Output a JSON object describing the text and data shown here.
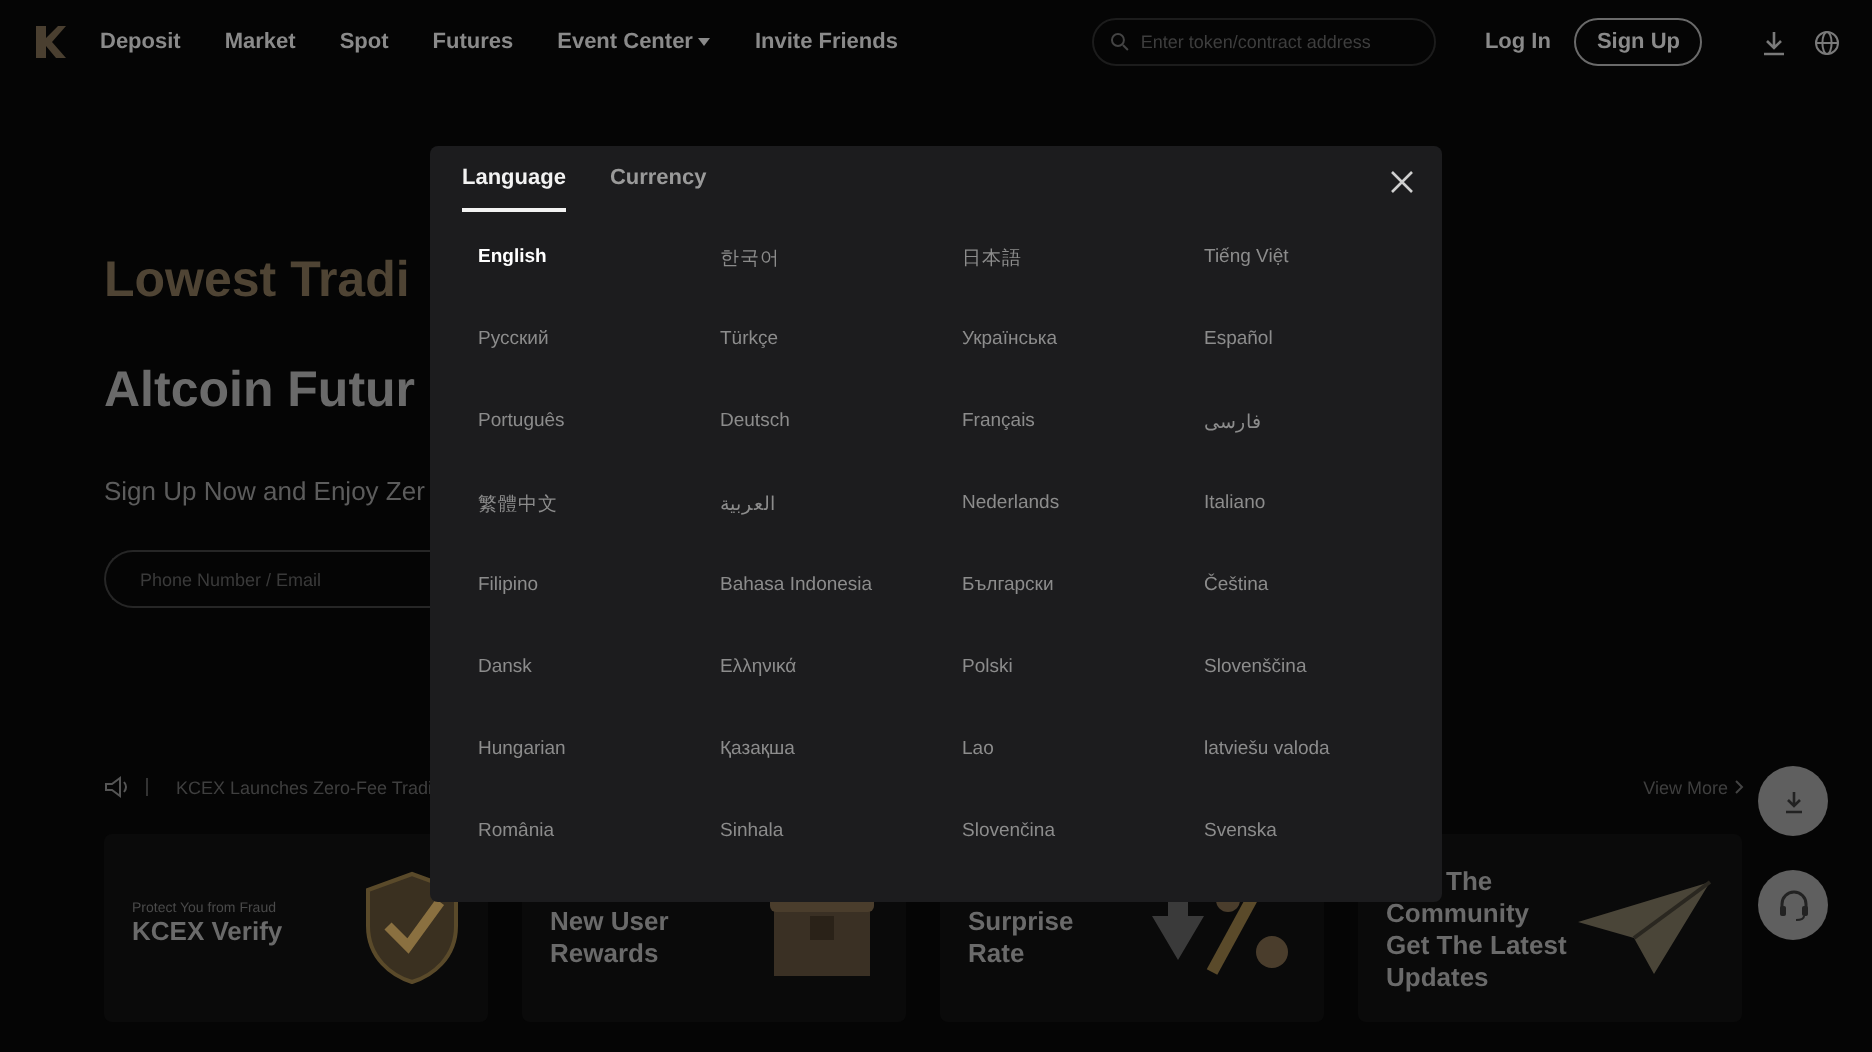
{
  "nav": {
    "links": [
      {
        "label": "Deposit",
        "dropdown": false
      },
      {
        "label": "Market",
        "dropdown": false
      },
      {
        "label": "Spot",
        "dropdown": false
      },
      {
        "label": "Futures",
        "dropdown": false
      },
      {
        "label": "Event Center",
        "dropdown": true
      },
      {
        "label": "Invite Friends",
        "dropdown": false
      }
    ],
    "search": {
      "placeholder": "Enter token/contract address"
    },
    "login": "Log In",
    "signup": "Sign Up"
  },
  "hero": {
    "headline": "Lowest Tradi",
    "subheadline": "Altcoin Futur",
    "tagline": "Sign Up Now and Enjoy Zer",
    "input": {
      "placeholder": "Phone Number / Email"
    }
  },
  "announcement": {
    "text": "KCEX Launches Zero-Fee Tradi",
    "more": "View More"
  },
  "cards": [
    {
      "kind": "shield",
      "caption": "Protect You from Fraud",
      "title": "KCEX Verify"
    },
    {
      "kind": "chest",
      "title": "New User Rewards"
    },
    {
      "kind": "percent",
      "title": "Surprise Rate"
    },
    {
      "kind": "plane",
      "title": "The Community Get The Latest Updates"
    }
  ],
  "modal": {
    "tabs": [
      {
        "label": "Language",
        "selected": true
      },
      {
        "label": "Currency",
        "selected": false
      }
    ],
    "languages": [
      {
        "label": "English",
        "selected": true
      },
      {
        "label": "한국어",
        "selected": false
      },
      {
        "label": "日本語",
        "selected": false
      },
      {
        "label": "Tiếng Việt",
        "selected": false
      },
      {
        "label": "Русский",
        "selected": false
      },
      {
        "label": "Türkçe",
        "selected": false
      },
      {
        "label": "Українська",
        "selected": false
      },
      {
        "label": "Español",
        "selected": false
      },
      {
        "label": "Português",
        "selected": false
      },
      {
        "label": "Deutsch",
        "selected": false
      },
      {
        "label": "Français",
        "selected": false
      },
      {
        "label": "فارسی",
        "selected": false
      },
      {
        "label": "繁體中文",
        "selected": false
      },
      {
        "label": "العربية",
        "selected": false
      },
      {
        "label": "Nederlands",
        "selected": false
      },
      {
        "label": "Italiano",
        "selected": false
      },
      {
        "label": "Filipino",
        "selected": false
      },
      {
        "label": "Bahasa Indonesia",
        "selected": false
      },
      {
        "label": "Български",
        "selected": false
      },
      {
        "label": "Čeština",
        "selected": false
      },
      {
        "label": "Dansk",
        "selected": false
      },
      {
        "label": "Ελληνικά",
        "selected": false
      },
      {
        "label": "Polski",
        "selected": false
      },
      {
        "label": "Slovenščina",
        "selected": false
      },
      {
        "label": "Hungarian",
        "selected": false
      },
      {
        "label": "Қазақша",
        "selected": false
      },
      {
        "label": "Lao",
        "selected": false
      },
      {
        "label": "latviešu valoda",
        "selected": false
      },
      {
        "label": "România",
        "selected": false
      },
      {
        "label": "Sinhala",
        "selected": false
      },
      {
        "label": "Slovenčina",
        "selected": false
      },
      {
        "label": "Svenska",
        "selected": false
      }
    ]
  }
}
